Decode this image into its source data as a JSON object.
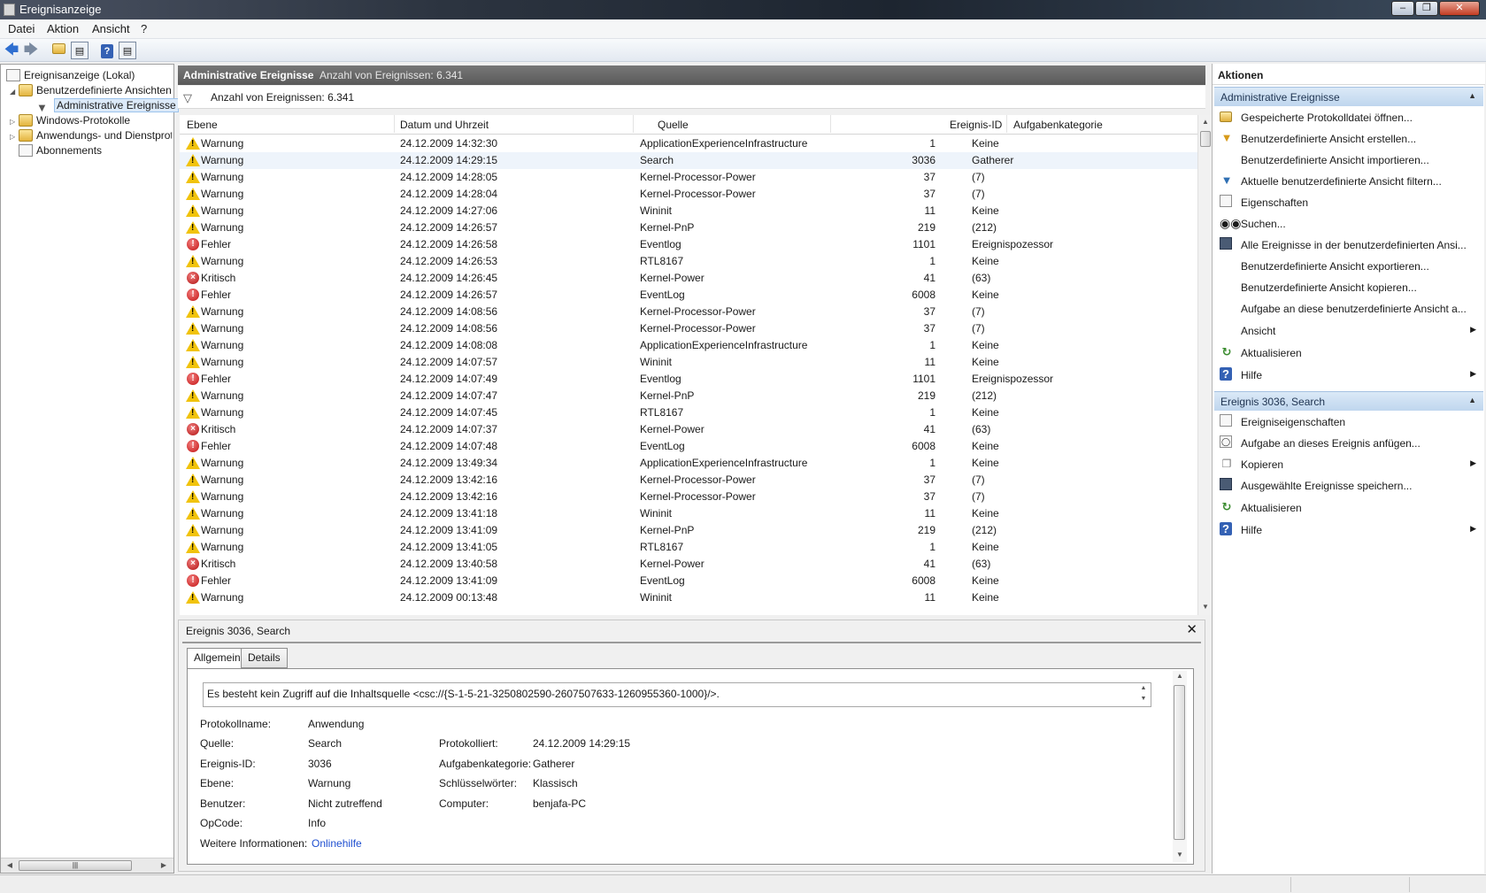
{
  "window": {
    "title": "Ereignisanzeige"
  },
  "menu": [
    "Datei",
    "Aktion",
    "Ansicht",
    "?"
  ],
  "tree": [
    {
      "label": "Ereignisanzeige (Lokal)"
    },
    {
      "label": "Benutzerdefinierte Ansichten"
    },
    {
      "label": "Administrative Ereignisse"
    },
    {
      "label": "Windows-Protokolle"
    },
    {
      "label": "Anwendungs- und Dienstprotokolle"
    },
    {
      "label": "Abonnements"
    }
  ],
  "center": {
    "header_title": "Administrative Ereignisse",
    "header_count": "Anzahl von Ereignissen: 6.341",
    "filter_text": "Anzahl von Ereignissen: 6.341",
    "columns": [
      "Ebene",
      "Datum und Uhrzeit",
      "Quelle",
      "Ereignis-ID",
      "Aufgabenkategorie"
    ]
  },
  "events": [
    {
      "level": "Warnung",
      "type": "warn",
      "datetime": "24.12.2009 14:32:30",
      "source": "ApplicationExperienceInfrastructure",
      "id": "1",
      "category": "Keine"
    },
    {
      "level": "Warnung",
      "type": "warn",
      "datetime": "24.12.2009 14:29:15",
      "source": "Search",
      "id": "3036",
      "category": "Gatherer"
    },
    {
      "level": "Warnung",
      "type": "warn",
      "datetime": "24.12.2009 14:28:05",
      "source": "Kernel-Processor-Power",
      "id": "37",
      "category": "(7)"
    },
    {
      "level": "Warnung",
      "type": "warn",
      "datetime": "24.12.2009 14:28:04",
      "source": "Kernel-Processor-Power",
      "id": "37",
      "category": "(7)"
    },
    {
      "level": "Warnung",
      "type": "warn",
      "datetime": "24.12.2009 14:27:06",
      "source": "Wininit",
      "id": "11",
      "category": "Keine"
    },
    {
      "level": "Warnung",
      "type": "warn",
      "datetime": "24.12.2009 14:26:57",
      "source": "Kernel-PnP",
      "id": "219",
      "category": "(212)"
    },
    {
      "level": "Fehler",
      "type": "err",
      "datetime": "24.12.2009 14:26:58",
      "source": "Eventlog",
      "id": "1101",
      "category": "Ereignispozessor"
    },
    {
      "level": "Warnung",
      "type": "warn",
      "datetime": "24.12.2009 14:26:53",
      "source": "RTL8167",
      "id": "1",
      "category": "Keine"
    },
    {
      "level": "Kritisch",
      "type": "crit",
      "datetime": "24.12.2009 14:26:45",
      "source": "Kernel-Power",
      "id": "41",
      "category": "(63)"
    },
    {
      "level": "Fehler",
      "type": "err",
      "datetime": "24.12.2009 14:26:57",
      "source": "EventLog",
      "id": "6008",
      "category": "Keine"
    },
    {
      "level": "Warnung",
      "type": "warn",
      "datetime": "24.12.2009 14:08:56",
      "source": "Kernel-Processor-Power",
      "id": "37",
      "category": "(7)"
    },
    {
      "level": "Warnung",
      "type": "warn",
      "datetime": "24.12.2009 14:08:56",
      "source": "Kernel-Processor-Power",
      "id": "37",
      "category": "(7)"
    },
    {
      "level": "Warnung",
      "type": "warn",
      "datetime": "24.12.2009 14:08:08",
      "source": "ApplicationExperienceInfrastructure",
      "id": "1",
      "category": "Keine"
    },
    {
      "level": "Warnung",
      "type": "warn",
      "datetime": "24.12.2009 14:07:57",
      "source": "Wininit",
      "id": "11",
      "category": "Keine"
    },
    {
      "level": "Fehler",
      "type": "err",
      "datetime": "24.12.2009 14:07:49",
      "source": "Eventlog",
      "id": "1101",
      "category": "Ereignispozessor"
    },
    {
      "level": "Warnung",
      "type": "warn",
      "datetime": "24.12.2009 14:07:47",
      "source": "Kernel-PnP",
      "id": "219",
      "category": "(212)"
    },
    {
      "level": "Warnung",
      "type": "warn",
      "datetime": "24.12.2009 14:07:45",
      "source": "RTL8167",
      "id": "1",
      "category": "Keine"
    },
    {
      "level": "Kritisch",
      "type": "crit",
      "datetime": "24.12.2009 14:07:37",
      "source": "Kernel-Power",
      "id": "41",
      "category": "(63)"
    },
    {
      "level": "Fehler",
      "type": "err",
      "datetime": "24.12.2009 14:07:48",
      "source": "EventLog",
      "id": "6008",
      "category": "Keine"
    },
    {
      "level": "Warnung",
      "type": "warn",
      "datetime": "24.12.2009 13:49:34",
      "source": "ApplicationExperienceInfrastructure",
      "id": "1",
      "category": "Keine"
    },
    {
      "level": "Warnung",
      "type": "warn",
      "datetime": "24.12.2009 13:42:16",
      "source": "Kernel-Processor-Power",
      "id": "37",
      "category": "(7)"
    },
    {
      "level": "Warnung",
      "type": "warn",
      "datetime": "24.12.2009 13:42:16",
      "source": "Kernel-Processor-Power",
      "id": "37",
      "category": "(7)"
    },
    {
      "level": "Warnung",
      "type": "warn",
      "datetime": "24.12.2009 13:41:18",
      "source": "Wininit",
      "id": "11",
      "category": "Keine"
    },
    {
      "level": "Warnung",
      "type": "warn",
      "datetime": "24.12.2009 13:41:09",
      "source": "Kernel-PnP",
      "id": "219",
      "category": "(212)"
    },
    {
      "level": "Warnung",
      "type": "warn",
      "datetime": "24.12.2009 13:41:05",
      "source": "RTL8167",
      "id": "1",
      "category": "Keine"
    },
    {
      "level": "Kritisch",
      "type": "crit",
      "datetime": "24.12.2009 13:40:58",
      "source": "Kernel-Power",
      "id": "41",
      "category": "(63)"
    },
    {
      "level": "Fehler",
      "type": "err",
      "datetime": "24.12.2009 13:41:09",
      "source": "EventLog",
      "id": "6008",
      "category": "Keine"
    },
    {
      "level": "Warnung",
      "type": "warn",
      "datetime": "24.12.2009 00:13:48",
      "source": "Wininit",
      "id": "11",
      "category": "Keine"
    }
  ],
  "detail": {
    "title": "Ereignis 3036, Search",
    "tabs": [
      "Allgemein",
      "Details"
    ],
    "message": "Es besteht kein Zugriff auf die Inhaltsquelle <csc://{S-1-5-21-3250802590-2607507633-1260955360-1000}/>.",
    "labels": {
      "log_name": "Protokollname:",
      "source": "Quelle:",
      "event_id": "Ereignis-ID:",
      "level": "Ebene:",
      "user": "Benutzer:",
      "opcode": "OpCode:",
      "more_info": "Weitere Informationen:",
      "logged": "Protokolliert:",
      "task_category": "Aufgabenkategorie:",
      "keywords": "Schlüsselwörter:",
      "computer": "Computer:"
    },
    "values": {
      "log_name": "Anwendung",
      "source": "Search",
      "event_id": "3036",
      "level": "Warnung",
      "user": "Nicht zutreffend",
      "opcode": "Info",
      "more_info": "Onlinehilfe",
      "logged": "24.12.2009 14:29:15",
      "task_category": "Gatherer",
      "keywords": "Klassisch",
      "computer": "benjafa-PC"
    }
  },
  "actions": {
    "title": "Aktionen",
    "section1": "Administrative Ereignisse",
    "items1": [
      "Gespeicherte Protokolldatei öffnen...",
      "Benutzerdefinierte Ansicht erstellen...",
      "Benutzerdefinierte Ansicht importieren...",
      "Aktuelle benutzerdefinierte Ansicht filtern...",
      "Eigenschaften",
      "Suchen...",
      "Alle Ereignisse in der benutzerdefinierten Ansi...",
      "Benutzerdefinierte Ansicht exportieren...",
      "Benutzerdefinierte Ansicht kopieren...",
      "Aufgabe an diese benutzerdefinierte Ansicht a...",
      "Ansicht",
      "Aktualisieren",
      "Hilfe"
    ],
    "section2": "Ereignis 3036, Search",
    "items2": [
      "Ereigniseigenschaften",
      "Aufgabe an dieses Ereignis anfügen...",
      "Kopieren",
      "Ausgewählte Ereignisse speichern...",
      "Aktualisieren",
      "Hilfe"
    ]
  }
}
